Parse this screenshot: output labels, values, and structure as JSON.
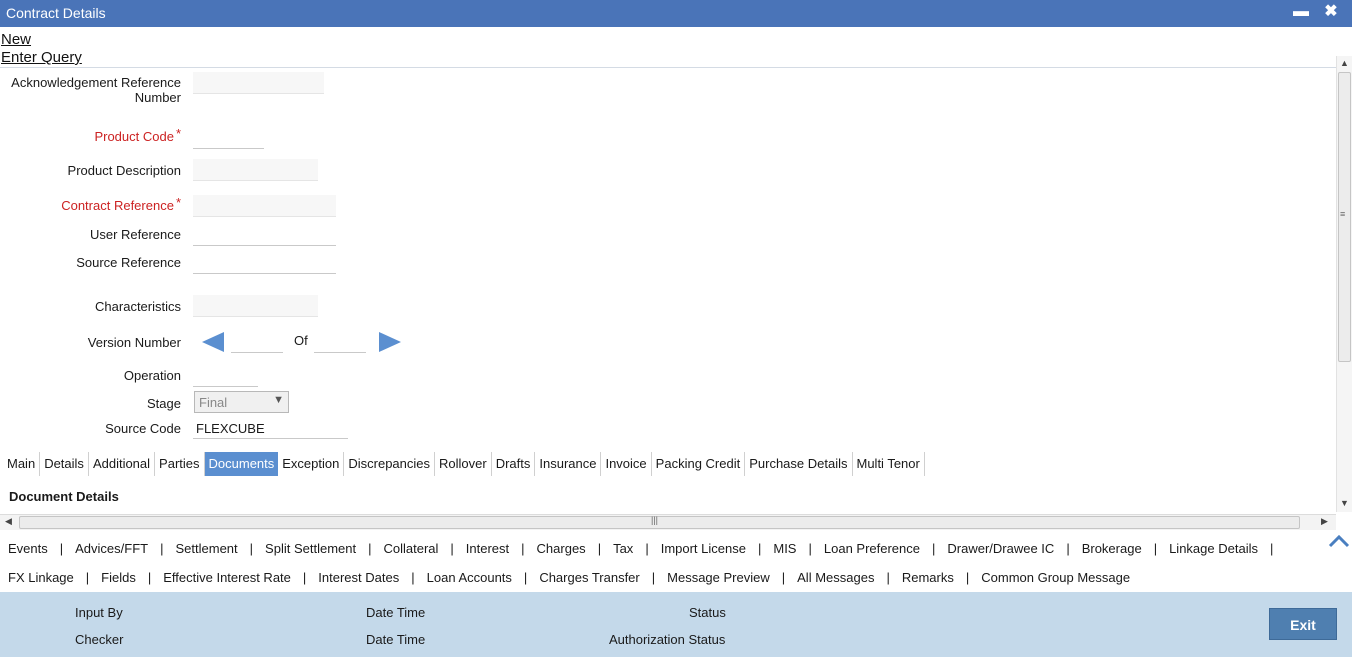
{
  "window": {
    "title": "Contract Details",
    "minimize_glyph": "▬",
    "close_glyph": "✖"
  },
  "menu": {
    "new_label": "New",
    "enter_query_label": "Enter Query"
  },
  "form": {
    "ack_ref_label_line1": "Acknowledgement Reference",
    "ack_ref_label_line2": "Number",
    "product_code_label": "Product Code",
    "product_desc_label": "Product Description",
    "contract_ref_label": "Contract Reference",
    "user_ref_label": "User Reference",
    "source_ref_label": "Source Reference",
    "characteristics_label": "Characteristics",
    "version_number_label": "Version Number",
    "version_of_label": "Of",
    "operation_label": "Operation",
    "stage_label": "Stage",
    "stage_value": "Final",
    "source_code_label": "Source Code",
    "source_code_value": "FLEXCUBE",
    "required_mark": "*"
  },
  "tabs": [
    {
      "label": "Main",
      "active": false
    },
    {
      "label": "Details",
      "active": false
    },
    {
      "label": "Additional",
      "active": false
    },
    {
      "label": "Parties",
      "active": false
    },
    {
      "label": "Documents",
      "active": true
    },
    {
      "label": "Exception",
      "active": false
    },
    {
      "label": "Discrepancies",
      "active": false
    },
    {
      "label": "Rollover",
      "active": false
    },
    {
      "label": "Drafts",
      "active": false
    },
    {
      "label": "Insurance",
      "active": false
    },
    {
      "label": "Invoice",
      "active": false
    },
    {
      "label": "Packing Credit",
      "active": false
    },
    {
      "label": "Purchase Details",
      "active": false
    },
    {
      "label": "Multi Tenor",
      "active": false
    }
  ],
  "section": {
    "document_details": "Document Details"
  },
  "subsystems_row1": [
    "Events",
    "Advices/FFT",
    "Settlement",
    "Split Settlement",
    "Collateral",
    "Interest",
    "Charges",
    "Tax",
    "Import License",
    "MIS",
    "Loan Preference",
    "Drawer/Drawee IC",
    "Brokerage",
    "Linkage Details"
  ],
  "subsystems_row2": [
    "FX Linkage",
    "Fields",
    "Effective Interest Rate",
    "Interest Dates",
    "Loan Accounts",
    "Charges Transfer",
    "Message Preview",
    "All Messages",
    "Remarks",
    "Common Group Message"
  ],
  "footer": {
    "input_by": "Input By",
    "date_time_1": "Date Time",
    "status": "Status",
    "checker": "Checker",
    "date_time_2": "Date Time",
    "auth_status": "Authorization Status",
    "exit": "Exit"
  },
  "icons": {
    "prev_version": "arrow-left-icon",
    "next_version": "arrow-right-icon",
    "collapse": "chevron-up-icon"
  },
  "colors": {
    "titlebar": "#4a74b8",
    "active_tab": "#5b8fd0",
    "required": "#cc2222",
    "footer": "#c4d9ea",
    "exit_button": "#4f7fb0"
  }
}
